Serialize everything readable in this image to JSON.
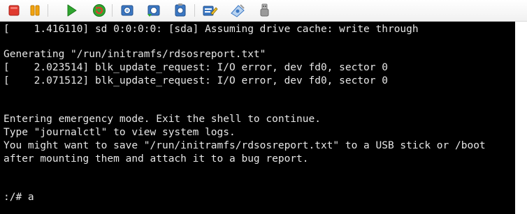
{
  "toolbar": {
    "buttons": [
      {
        "name": "power-off-button",
        "icon": "stop-square-icon",
        "color": "#e03a2f"
      },
      {
        "name": "suspend-button",
        "icon": "pause-icon",
        "color": "#f2a30f"
      },
      {
        "name": "power-on-button",
        "icon": "play-icon",
        "color": "#2fa52f"
      },
      {
        "name": "reset-button",
        "icon": "reset-icon",
        "color": "#d8402d"
      },
      {
        "name": "snapshot-button",
        "icon": "snapshot-icon",
        "color": "#3b78c4"
      },
      {
        "name": "revert-snapshot-button",
        "icon": "revert-snapshot-icon",
        "color": "#3b78c4"
      },
      {
        "name": "snapshot-manager-button",
        "icon": "snapshot-manager-icon",
        "color": "#3b78c4"
      },
      {
        "name": "edit-settings-button",
        "icon": "edit-settings-icon",
        "color": "#3b78c4"
      },
      {
        "name": "connect-device-button",
        "icon": "cd-dvd-icon",
        "color": "#3b78c4"
      },
      {
        "name": "disconnect-device-button",
        "icon": "usb-device-icon",
        "color": "#9a9a9a"
      }
    ]
  },
  "console": {
    "lines": [
      "[    1.416110] sd 0:0:0:0: [sda] Assuming drive cache: write through",
      "",
      "Generating \"/run/initramfs/rdsosreport.txt\"",
      "[    2.023514] blk_update_request: I/O error, dev fd0, sector 0",
      "[    2.071512] blk_update_request: I/O error, dev fd0, sector 0",
      "",
      "",
      "Entering emergency mode. Exit the shell to continue.",
      "Type \"journalctl\" to view system logs.",
      "You might want to save \"/run/initramfs/rdsosreport.txt\" to a USB stick or /boot",
      "after mounting them and attach it to a bug report.",
      "",
      "",
      ":/# a"
    ],
    "text_color": "#e6e6e6",
    "background": "#000000"
  }
}
